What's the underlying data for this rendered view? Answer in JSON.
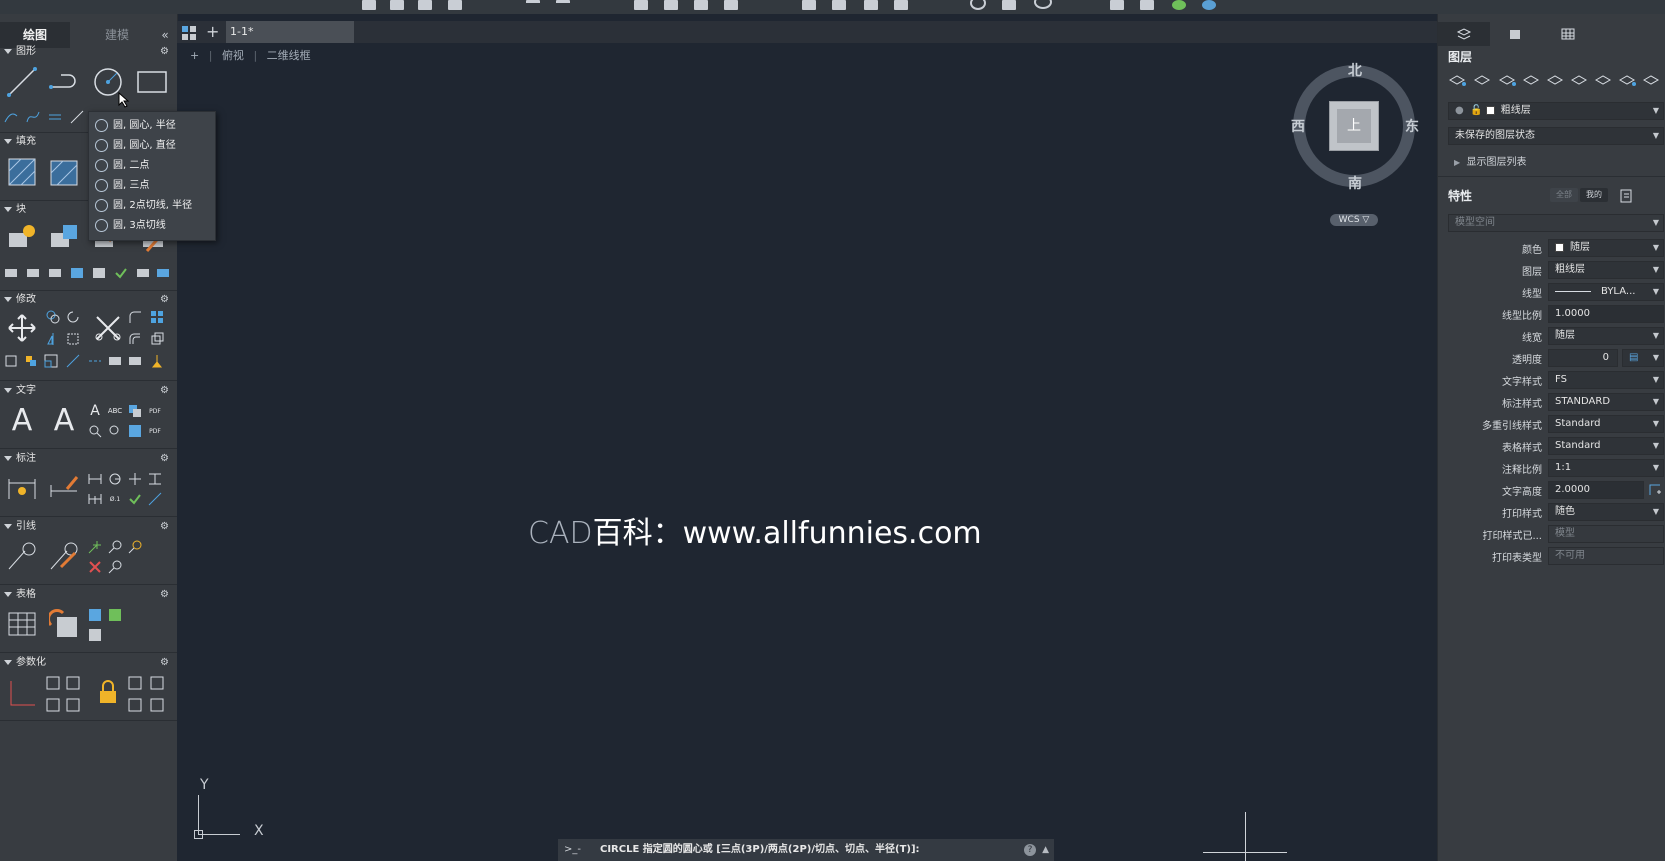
{
  "left_palette": {
    "tabs": [
      "绘图",
      "建模"
    ],
    "collapse_label": "«",
    "sections": {
      "draw": "图形",
      "hatch": "填充",
      "block": "块",
      "modify": "修改",
      "text": "文字",
      "dimension": "标注",
      "leader": "引线",
      "table": "表格",
      "parametric": "参数化"
    },
    "gear_icon": "⚙"
  },
  "circle_dropdown": {
    "items": [
      "圆, 圆心, 半径",
      "圆, 圆心, 直径",
      "圆, 二点",
      "圆, 三点",
      "圆, 2点切线, 半径",
      "圆, 3点切线"
    ]
  },
  "doc_tabs": {
    "active": "1-1*",
    "add_label": "+"
  },
  "view_controls": {
    "plus": "+",
    "view": "俯视",
    "visual_style": "二维线框"
  },
  "watermark": {
    "prefix": "CAD",
    "text": "百科：www.allfunnies.com"
  },
  "viewcube": {
    "north": "北",
    "south": "南",
    "east": "东",
    "west": "西",
    "face": "上",
    "wcs": "WCS ▽"
  },
  "ucs": {
    "x": "X",
    "y": "Y"
  },
  "command_line": {
    "prompt": ">_-",
    "text": "CIRCLE 指定圆的圆心或 [三点(3P)/两点(2P)/切点、切点、半径(T)]:",
    "help": "?",
    "expand": "▲"
  },
  "layers_panel": {
    "title": "图层",
    "current_layer": "粗线层",
    "layer_state": "未保存的图层状态",
    "show_list": "显示图层列表"
  },
  "properties_panel": {
    "title": "特性",
    "toggle_all": "全部",
    "toggle_mine": "我的",
    "space": "模型空间",
    "rows": [
      {
        "label": "颜色",
        "value": "随层"
      },
      {
        "label": "图层",
        "value": "粗线层"
      },
      {
        "label": "线型",
        "value": "BYLA..."
      },
      {
        "label": "线型比例",
        "value": "1.0000"
      },
      {
        "label": "线宽",
        "value": "随层"
      },
      {
        "label": "透明度",
        "value": "0"
      },
      {
        "label": "文字样式",
        "value": "FS"
      },
      {
        "label": "标注样式",
        "value": "STANDARD"
      },
      {
        "label": "多重引线样式",
        "value": "Standard"
      },
      {
        "label": "表格样式",
        "value": "Standard"
      },
      {
        "label": "注释比例",
        "value": "1:1"
      },
      {
        "label": "文字高度",
        "value": "2.0000"
      },
      {
        "label": "打印样式",
        "value": "随色"
      },
      {
        "label": "打印样式已...",
        "value": "模型"
      },
      {
        "label": "打印表类型",
        "value": "不可用"
      }
    ]
  }
}
